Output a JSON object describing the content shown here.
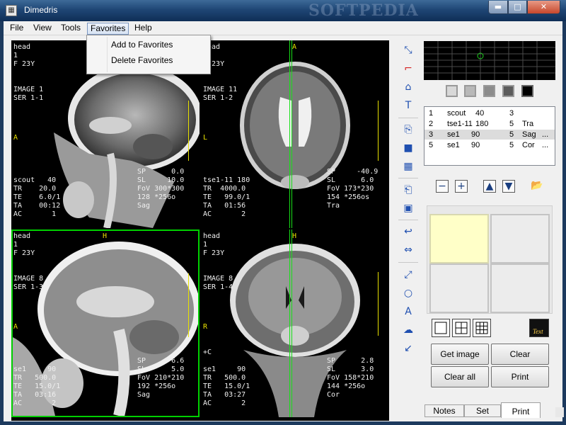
{
  "window": {
    "title": "Dimedris",
    "watermark": "SOFTPEDIA",
    "min_label": "▬",
    "max_label": "□",
    "close_label": "✕"
  },
  "menu": {
    "items": [
      "File",
      "View",
      "Tools",
      "Favorites",
      "Help"
    ],
    "open_menu": "Favorites",
    "favorites_items": [
      "Add to Favorites",
      "Delete Favorites"
    ]
  },
  "panes": [
    {
      "header": "head\n1\nF 23Y",
      "image": "IMAGE 1\nSER 1-1",
      "orient_left": "A",
      "orient_top": "",
      "bottom_left": "scout   40\nTR    20.0\nTE    6.0/1\nTA    00:12\nAC       1",
      "bottom_right": "SP      0.0\nSL     10.0\nFoV 300*300\n128 *256o\nSag",
      "view": "sagittal"
    },
    {
      "header": "head\n1\nF 23Y",
      "image": "IMAGE 11\nSER 1-2",
      "orient_left": "L",
      "orient_top": "A",
      "bottom_left": "tse1-11 180\nTR  4000.0\nTE   99.0/1\nTA   01:56\nAC       2",
      "bottom_right": "SP     -40.9\nSL      6.0\nFoV 173*230\n154 *256os\nTra",
      "view": "axial"
    },
    {
      "header": "head\n1\nF 23Y",
      "image": "IMAGE 8\nSER 1-3",
      "orient_left": "A",
      "orient_top": "H",
      "bottom_left": "se1     90\nTR   500.0\nTE   15.0/1\nTA   03:16\nAC       2",
      "bottom_right": "SP      6.6\nSL      5.0\nFoV 210*210\n192 *256o\nSag",
      "view": "sagittal2"
    },
    {
      "header": "head\n1\nF 23Y",
      "image": "IMAGE 8\nSER 1-4",
      "orient_left": "R",
      "orient_top": "H",
      "bottom_left": "+C\n\nse1     90\nTR   500.0\nTE   15.0/1\nTA   03:27\nAC       2",
      "bottom_right": "SP      2.8\nSL      3.0\nFoV 158*210\n144 *256o\nCor",
      "view": "coronal"
    }
  ],
  "series": {
    "rows": [
      {
        "n": "1",
        "name": "scout",
        "count": "40",
        "ser": "3",
        "orient": ""
      },
      {
        "n": "2",
        "name": "tse1-11",
        "count": "180",
        "ser": "5",
        "orient": "Tra"
      },
      {
        "n": "3",
        "name": "se1",
        "count": "90",
        "ser": "5",
        "orient": "Sag"
      },
      {
        "n": "5",
        "name": "se1",
        "count": "90",
        "ser": "5",
        "orient": "Cor"
      }
    ],
    "more_marker": "...",
    "selected_index": 2
  },
  "controls": {
    "get_image": "Get image",
    "clear": "Clear",
    "clear_all": "Clear all",
    "print": "Print",
    "text_thumb": "Text"
  },
  "tabs": [
    "Notes",
    "Set",
    "Print"
  ],
  "selected_tab": "Print",
  "colors": {
    "accent": "#1f4fb0",
    "active_pane_border": "#00d000",
    "reference_line": "#18e018",
    "overlay_text": "#f0f0f0",
    "ruler": "#e8e000",
    "selected_cell": "#ffffc8"
  }
}
